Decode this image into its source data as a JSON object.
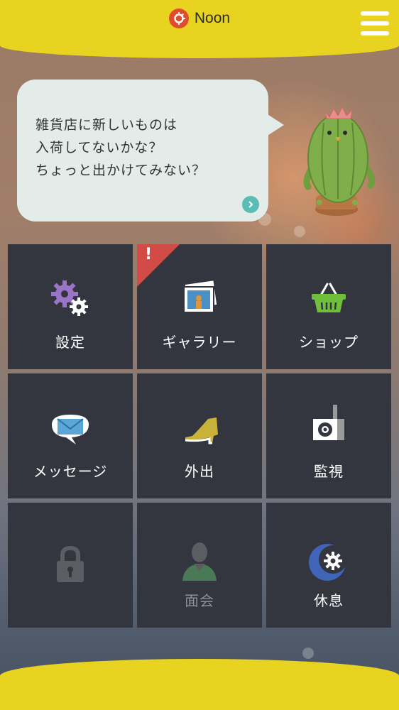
{
  "app": {
    "name": "Noon"
  },
  "header": {
    "menu_icon": "hamburger-menu-icon"
  },
  "bubble": {
    "lines": [
      "雑貨店に新しいものは",
      "入荷してないかな？",
      "ちょっと出かけてみない？"
    ],
    "next_icon": "chevron-right-icon"
  },
  "menu": [
    {
      "label": "設定",
      "icon": "gears-icon",
      "badge": false
    },
    {
      "label": "ギャラリー",
      "icon": "photos-icon",
      "badge": true,
      "badge_mark": "!"
    },
    {
      "label": "ショップ",
      "icon": "basket-icon",
      "badge": false
    },
    {
      "label": "メッセージ",
      "icon": "envelope-icon",
      "badge": false
    },
    {
      "label": "外出",
      "icon": "shoe-icon",
      "badge": false
    },
    {
      "label": "監視",
      "icon": "speaker-icon",
      "badge": false
    },
    {
      "label": "",
      "icon": "lock-icon",
      "badge": false,
      "locked": true
    },
    {
      "label": "面会",
      "icon": "person-icon",
      "badge": false,
      "disabled": true
    },
    {
      "label": "休息",
      "icon": "moon-gear-icon",
      "badge": false
    }
  ],
  "colors": {
    "accent_yellow": "#e8d321",
    "tile": "#33353f",
    "badge_red": "#d24b46",
    "bubble": "#e3ece9",
    "next_button": "#5bbcb4"
  }
}
